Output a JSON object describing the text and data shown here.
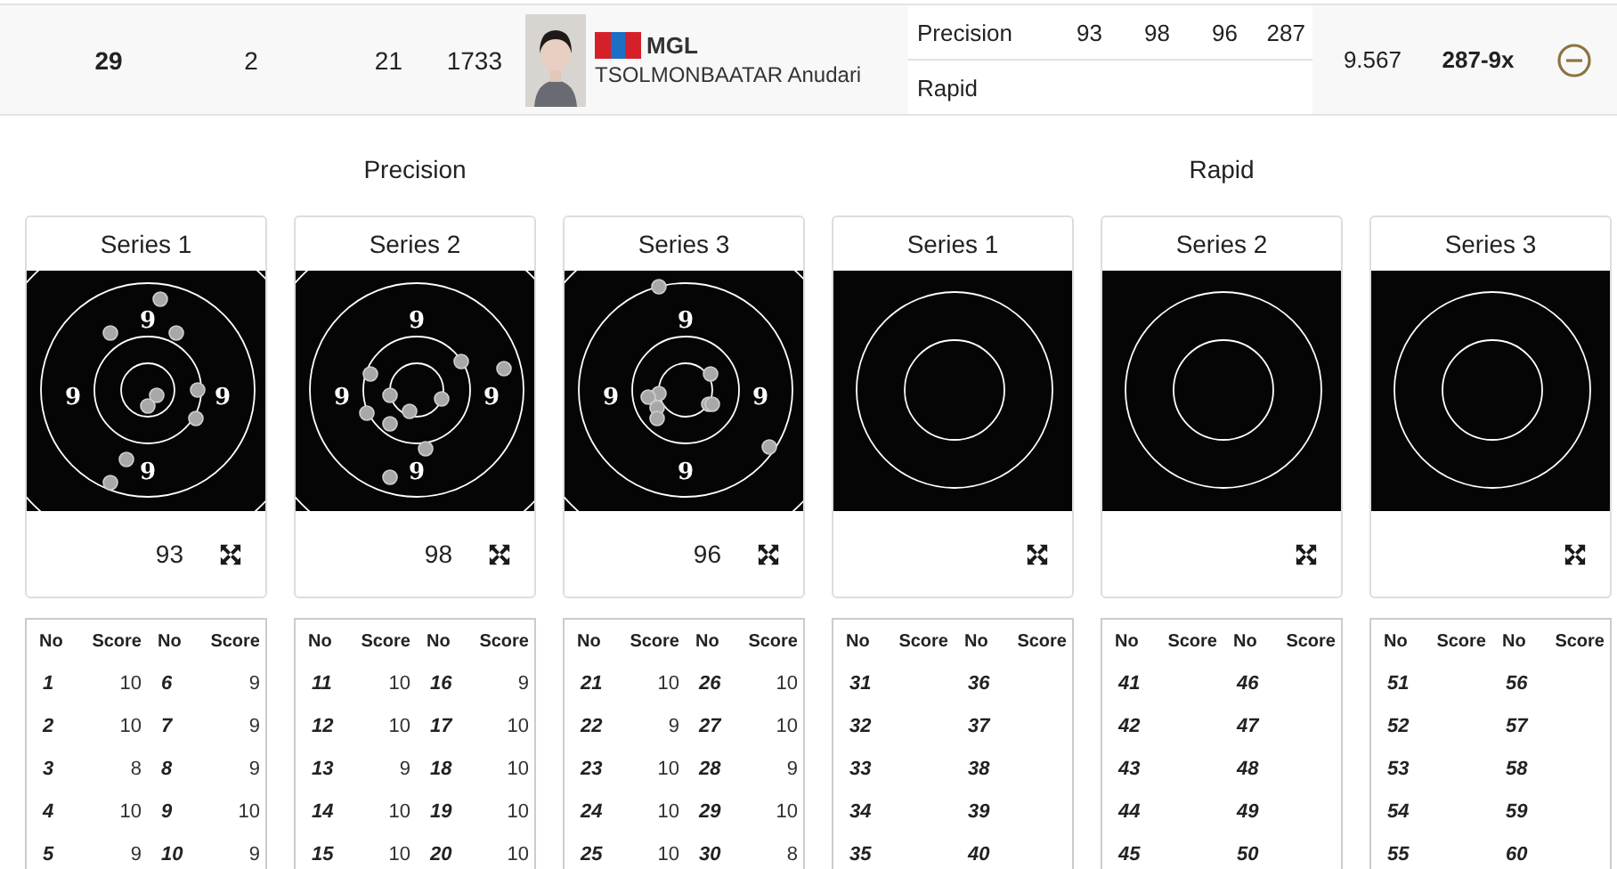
{
  "result_row": {
    "rank": "29",
    "column_2": "2",
    "column_3": "21",
    "column_4": "1733",
    "country": "MGL",
    "athlete": "TSOLMONBAATAR Anudari",
    "stages": [
      {
        "name": "Precision",
        "scores": [
          "93",
          "98",
          "96",
          "287"
        ]
      },
      {
        "name": "Rapid"
      }
    ],
    "column_9": "9.567",
    "total": "287-9x",
    "expanded": true
  },
  "stages": [
    {
      "title": "Precision",
      "series": [
        {
          "title": "Series 1",
          "kind": "precision",
          "score": "93",
          "ring_labels": [
            "9",
            "9",
            "9",
            "9"
          ],
          "headers": [
            "No",
            "Score",
            "No",
            "Score"
          ],
          "shots": [
            {
              "no": "1",
              "score": "10"
            },
            {
              "no": "6",
              "score": "9"
            },
            {
              "no": "2",
              "score": "10"
            },
            {
              "no": "7",
              "score": "9"
            },
            {
              "no": "3",
              "score": "8"
            },
            {
              "no": "8",
              "score": "9"
            },
            {
              "no": "4",
              "score": "10"
            },
            {
              "no": "9",
              "score": "10"
            },
            {
              "no": "5",
              "score": "9"
            },
            {
              "no": "10",
              "score": "9"
            }
          ]
        },
        {
          "title": "Series 2",
          "kind": "precision",
          "score": "98",
          "ring_labels": [
            "9",
            "9",
            "9",
            "9"
          ],
          "headers": [
            "No",
            "Score",
            "No",
            "Score"
          ],
          "shots": [
            {
              "no": "11",
              "score": "10"
            },
            {
              "no": "16",
              "score": "9"
            },
            {
              "no": "12",
              "score": "10"
            },
            {
              "no": "17",
              "score": "10"
            },
            {
              "no": "13",
              "score": "9"
            },
            {
              "no": "18",
              "score": "10"
            },
            {
              "no": "14",
              "score": "10"
            },
            {
              "no": "19",
              "score": "10"
            },
            {
              "no": "15",
              "score": "10"
            },
            {
              "no": "20",
              "score": "10"
            }
          ]
        },
        {
          "title": "Series 3",
          "kind": "precision",
          "score": "96",
          "ring_labels": [
            "9",
            "9",
            "9",
            "9"
          ],
          "headers": [
            "No",
            "Score",
            "No",
            "Score"
          ],
          "shots": [
            {
              "no": "21",
              "score": "10"
            },
            {
              "no": "26",
              "score": "10"
            },
            {
              "no": "22",
              "score": "9"
            },
            {
              "no": "27",
              "score": "10"
            },
            {
              "no": "23",
              "score": "10"
            },
            {
              "no": "28",
              "score": "9"
            },
            {
              "no": "24",
              "score": "10"
            },
            {
              "no": "29",
              "score": "10"
            },
            {
              "no": "25",
              "score": "10"
            },
            {
              "no": "30",
              "score": "8"
            }
          ]
        }
      ]
    },
    {
      "title": "Rapid",
      "series": [
        {
          "title": "Series 1",
          "kind": "rapid",
          "headers": [
            "No",
            "Score",
            "No",
            "Score"
          ],
          "shots": [
            {
              "no": "31"
            },
            {
              "no": "36"
            },
            {
              "no": "32"
            },
            {
              "no": "37"
            },
            {
              "no": "33"
            },
            {
              "no": "38"
            },
            {
              "no": "34"
            },
            {
              "no": "39"
            },
            {
              "no": "35"
            },
            {
              "no": "40"
            }
          ]
        },
        {
          "title": "Series 2",
          "kind": "rapid",
          "headers": [
            "No",
            "Score",
            "No",
            "Score"
          ],
          "shots": [
            {
              "no": "41"
            },
            {
              "no": "46"
            },
            {
              "no": "42"
            },
            {
              "no": "47"
            },
            {
              "no": "43"
            },
            {
              "no": "48"
            },
            {
              "no": "44"
            },
            {
              "no": "49"
            },
            {
              "no": "45"
            },
            {
              "no": "50"
            }
          ]
        },
        {
          "title": "Series 3",
          "kind": "rapid",
          "headers": [
            "No",
            "Score",
            "No",
            "Score"
          ],
          "shots": [
            {
              "no": "51"
            },
            {
              "no": "56"
            },
            {
              "no": "52"
            },
            {
              "no": "57"
            },
            {
              "no": "53"
            },
            {
              "no": "58"
            },
            {
              "no": "54"
            },
            {
              "no": "59"
            },
            {
              "no": "55"
            },
            {
              "no": "60"
            }
          ]
        }
      ]
    }
  ]
}
